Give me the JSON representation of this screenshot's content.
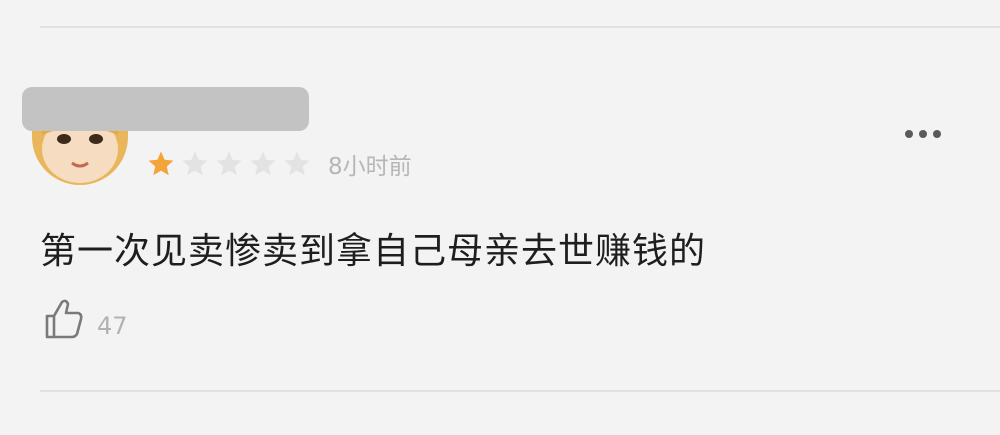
{
  "review": {
    "rating": 1,
    "rating_max": 5,
    "time": "8小时前",
    "comment": "第一次见卖惨卖到拿自己母亲去世赚钱的",
    "like_count": "47"
  },
  "icons": {
    "avatar": "cartoon-avatar",
    "rating": "star-icon",
    "more": "more-dots-icon",
    "like": "thumbs-up-icon"
  },
  "colors": {
    "background": "#f4f3f3",
    "star_filled": "#f3a43a",
    "star_empty": "#e4e3e3",
    "text_primary": "#1e1e1e",
    "text_secondary": "#b7b6b6"
  }
}
